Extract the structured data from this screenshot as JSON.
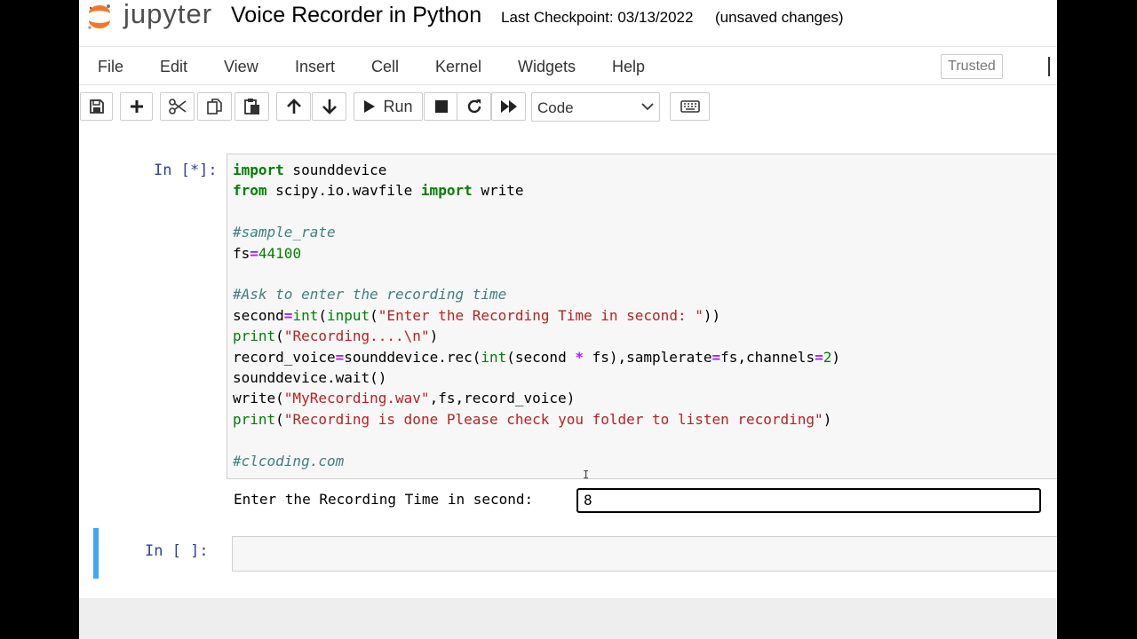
{
  "header": {
    "logo_text": "jupyter",
    "notebook_title": "Voice Recorder in Python",
    "checkpoint": "Last Checkpoint: 03/13/2022",
    "unsaved": "(unsaved changes)"
  },
  "menubar": {
    "items": [
      "File",
      "Edit",
      "View",
      "Insert",
      "Cell",
      "Kernel",
      "Widgets",
      "Help"
    ],
    "trusted": "Trusted"
  },
  "toolbar": {
    "run_label": "Run",
    "cell_type": "Code"
  },
  "cells": [
    {
      "prompt": "In [*]:",
      "code_lines": [
        "import sounddevice",
        "from scipy.io.wavfile import write",
        "",
        "#sample_rate",
        "fs=44100",
        "",
        "#Ask to enter the recording time",
        "second=int(input(\"Enter the Recording Time in second: \"))",
        "print(\"Recording....\\n\")",
        "record_voice=sounddevice.rec(int(second * fs),samplerate=fs,channels=2)",
        "sounddevice.wait()",
        "write(\"MyRecording.wav\",fs,record_voice)",
        "print(\"Recording is done Please check you folder to listen recording\")",
        "",
        "#clcoding.com"
      ],
      "stdin_prompt": "Enter the Recording Time in second:",
      "stdin_value": "8"
    },
    {
      "prompt": "In [ ]:"
    }
  ],
  "colors": {
    "prompt": "#303f9f",
    "keyword": "#008000",
    "string": "#ba2121",
    "comment": "#408080",
    "operator": "#aa22ff",
    "selected_cell": "#42a5f5"
  }
}
